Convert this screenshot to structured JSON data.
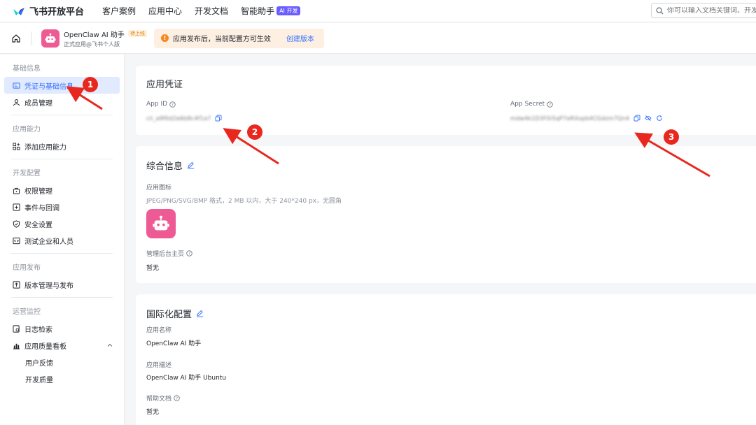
{
  "topbar": {
    "logo_text": "飞书开放平台",
    "nav": [
      "客户案例",
      "应用中心",
      "开发文档",
      "智能助手"
    ],
    "ai_badge": "AI 开发",
    "search_placeholder": "你可以输入文档关键词、开发问题"
  },
  "appbar": {
    "app_name": "OpenClaw AI 助手",
    "status_tag": "待上线",
    "app_sub": "正式应用@飞书个人版",
    "notice_text": "应用发布后，当前配置方可生效",
    "notice_link": "创建版本"
  },
  "sidebar": {
    "groups": [
      {
        "title": "基础信息",
        "items": [
          "凭证与基础信息",
          "成员管理"
        ]
      },
      {
        "title": "应用能力",
        "items": [
          "添加应用能力"
        ]
      },
      {
        "title": "开发配置",
        "items": [
          "权限管理",
          "事件与回调",
          "安全设置",
          "测试企业和人员"
        ]
      },
      {
        "title": "应用发布",
        "items": [
          "版本管理与发布"
        ]
      },
      {
        "title": "运营监控",
        "items": [
          "日志检索",
          "应用质量看板",
          "用户反馈",
          "开发质量"
        ]
      }
    ]
  },
  "credentials": {
    "title": "应用凭证",
    "app_id_label": "App ID",
    "app_id_value": "cli_a9f0d2e6b8c4f1a7",
    "app_secret_label": "App Secret",
    "app_secret_value": "mdw4k1D3F0i5qP7eRXopb4CGdzm7Qn4"
  },
  "general": {
    "title": "综合信息",
    "icon_label": "应用图标",
    "icon_hint": "JPEG/PNG/SVG/BMP 格式，2 MB 以内，大于 240*240 px，无圆角",
    "admin_label": "管理后台主页",
    "admin_value": "暂无"
  },
  "i18n": {
    "title": "国际化配置",
    "name_label": "应用名称",
    "name_value": "OpenClaw AI 助手",
    "desc_label": "应用描述",
    "desc_value": "OpenClaw AI 助手 Ubuntu",
    "help_label": "帮助文档",
    "help_value": "暂无"
  },
  "markers": [
    "1",
    "2",
    "3"
  ],
  "colors": {
    "accent": "#3370ff",
    "annotation": "#e8281f",
    "app_icon": "#ee5a93"
  }
}
